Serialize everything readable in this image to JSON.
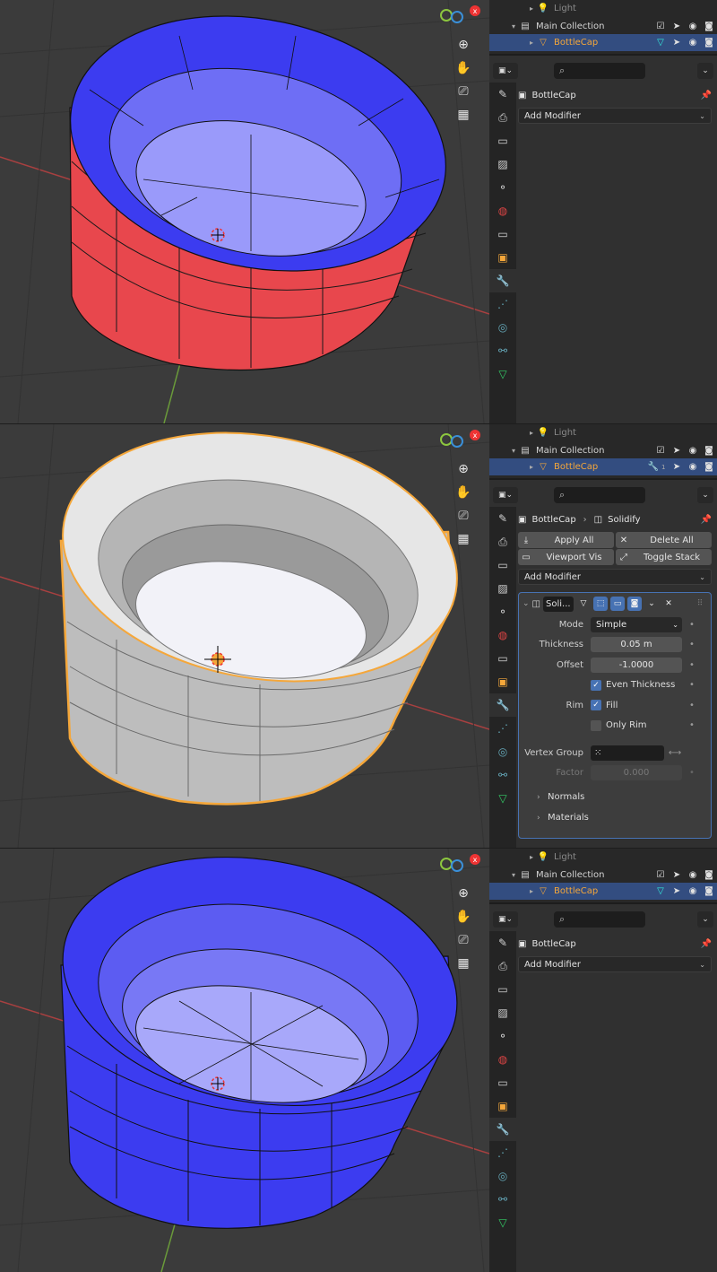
{
  "panels": [
    {
      "outliner": {
        "row_light": "Light",
        "row_collection": "Main Collection",
        "row_object": "BottleCap"
      },
      "props": {
        "object_name": "BottleCap",
        "add_modifier": "Add Modifier"
      },
      "style": {
        "top": "#3c3cf0",
        "side": "#e8474d"
      }
    },
    {
      "outliner": {
        "row_light": "Light",
        "row_collection": "Main Collection",
        "row_object": "BottleCap",
        "modifier_badge": "1"
      },
      "props": {
        "object_name": "BottleCap",
        "modifier_crumb": "Solidify",
        "apply_all": "Apply All",
        "delete_all": "Delete All",
        "viewport_vis": "Viewport Vis",
        "toggle_stack": "Toggle Stack",
        "add_modifier": "Add Modifier",
        "modifier": {
          "name": "Soli...",
          "mode_label": "Mode",
          "mode_value": "Simple",
          "thickness_label": "Thickness",
          "thickness_value": "0.05 m",
          "offset_label": "Offset",
          "offset_value": "-1.0000",
          "even_thickness": "Even Thickness",
          "rim_label": "Rim",
          "fill": "Fill",
          "only_rim": "Only Rim",
          "vertex_group_label": "Vertex Group",
          "factor_label": "Factor",
          "factor_value": "0.000",
          "normals": "Normals",
          "materials": "Materials"
        }
      },
      "style": {
        "top": "#c8c8c8",
        "side": "#bdbdbd"
      }
    },
    {
      "outliner": {
        "row_light": "Light",
        "row_collection": "Main Collection",
        "row_object": "BottleCap"
      },
      "props": {
        "object_name": "BottleCap",
        "add_modifier": "Add Modifier"
      },
      "style": {
        "top": "#3c3cf0",
        "side": "#3c3cf0"
      }
    }
  ],
  "colors": {
    "viewport_bg": "#3b3b3b",
    "accent_blue": "#4772b3",
    "selection_orange": "#f5a73a",
    "face_select_blue": "#3c3cf0",
    "face_select_red": "#e8474d"
  },
  "icons": {
    "viewport_tools": [
      "zoom-icon",
      "hand-pan-icon",
      "camera-icon",
      "grid-icon"
    ],
    "property_tabs": [
      "tool-icon",
      "render-icon",
      "output-icon",
      "view-layer-icon",
      "scene-icon",
      "world-icon",
      "collection-icon",
      "object-icon",
      "modifier-icon",
      "particles-icon",
      "physics-icon",
      "constraints-icon",
      "data-icon"
    ]
  }
}
